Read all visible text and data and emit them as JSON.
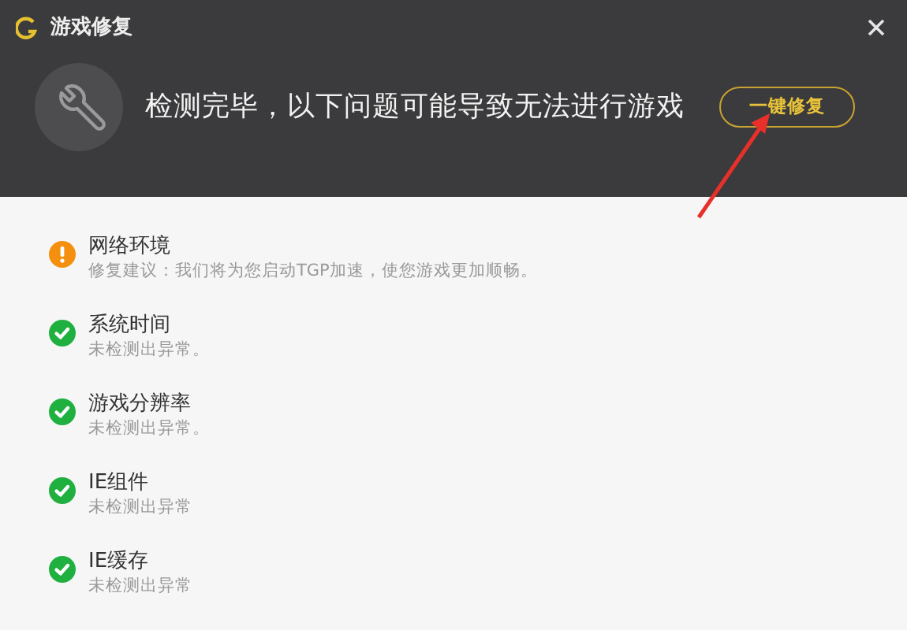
{
  "window": {
    "title": "游戏修复"
  },
  "header": {
    "message": "检测完毕，以下问题可能导致无法进行游戏",
    "button": "一键修复"
  },
  "items": [
    {
      "kind": "warning",
      "title": "网络环境",
      "detail": "修复建议：我们将为您启动TGP加速，使您游戏更加顺畅。"
    },
    {
      "kind": "ok",
      "title": "系统时间",
      "detail": "未检测出异常。"
    },
    {
      "kind": "ok",
      "title": "游戏分辨率",
      "detail": "未检测出异常。"
    },
    {
      "kind": "ok",
      "title": "IE组件",
      "detail": "未检测出异常"
    },
    {
      "kind": "ok",
      "title": "IE缓存",
      "detail": "未检测出异常"
    }
  ]
}
